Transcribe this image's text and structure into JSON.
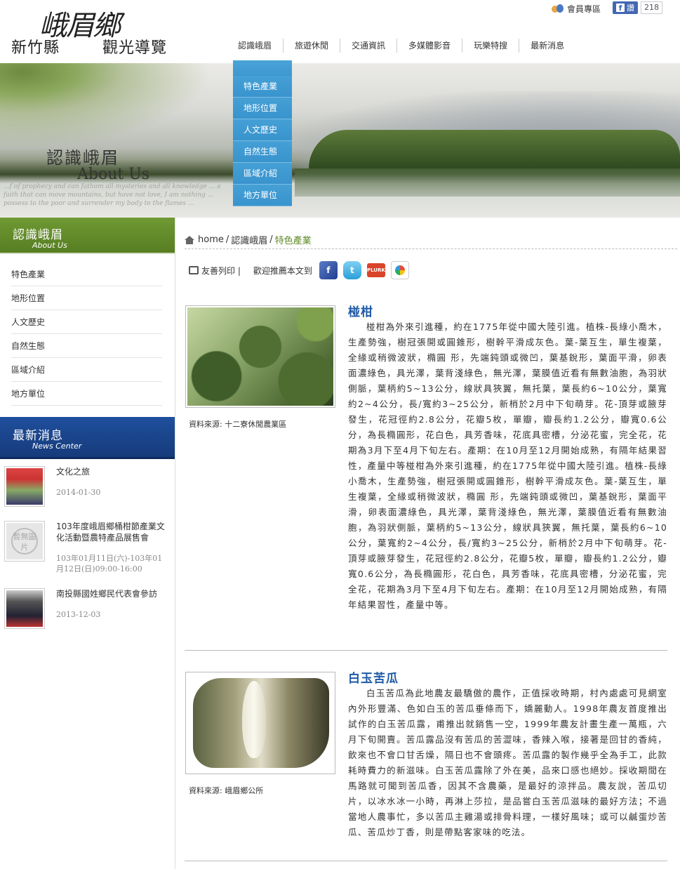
{
  "logo": {
    "prefix": "新竹縣",
    "big": "峨眉鄉",
    "suffix": "觀光導覽"
  },
  "header": {
    "member_label": "會員專區",
    "fb_label": "讚",
    "fb_count": "218",
    "nav": [
      "認識峨眉",
      "旅遊休閒",
      "交通資訊",
      "多媒體影音",
      "玩樂特搜",
      "最新消息"
    ]
  },
  "dropdown": [
    "特色產業",
    "地形位置",
    "人文歷史",
    "自然生態",
    "區域介紹",
    "地方單位"
  ],
  "banner": {
    "title_zh": "認識峨眉",
    "title_en": "About Us",
    "script": "...f of prophecy and can fathom all mysteries and all knowledge ... a faith that can move mountains, but have not love, I am nothing ... possess to the poor and surrender my body to the flames ..."
  },
  "sidebar": {
    "section_zh": "認識峨眉",
    "section_en": "About Us",
    "items": [
      "特色產業",
      "地形位置",
      "人文歷史",
      "自然生態",
      "區域介紹",
      "地方單位"
    ],
    "news_zh": "最新消息",
    "news_en": "News Center",
    "news": [
      {
        "title": "文化之旅",
        "date": "2014-01-30"
      },
      {
        "title": "103年度峨眉鄉桶柑節產業文化活動暨農特產品展售會",
        "date": "103年01月11日(六)-103年01月12日(日)09:00-16:00",
        "placeholder": "暫無圖片"
      },
      {
        "title": "南投縣國姓鄉民代表會參訪",
        "date": "2013-12-03"
      }
    ]
  },
  "breadcrumb": {
    "home": "home",
    "level1": "認識峨眉",
    "current": "特色產業",
    "sep": "/"
  },
  "share": {
    "print_label": "友善列印 |",
    "recommend_label": "歡迎推薦本文到",
    "plurk": "PLURK"
  },
  "products": [
    {
      "title": "椪柑",
      "source": "資料來源: 十二寮休閒農業區",
      "text": "椪柑為外來引進種，約在1775年從中國大陸引進。植株-長綠小喬木，生產勢強，樹冠張開或圓錐形，樹幹平滑成灰色。葉-葉互生，單生複葉，全緣或稍微波狀，橢圓 形，先端鈍頭或微凹，葉基銳形，葉面平滑，卵表面濃綠色，具光澤，葉背淺綠色，無光澤，葉膜值近看有無數油胞，為羽狀側脈，葉柄約5~13公分，線狀具狹翼，無托葉，葉長約6~10公分，葉寬約2~4公分，長/寬約3~25公分，新梢於2月中下旬萌芽。花-頂芽或腋芽發生，花冠徑約2.8公分，花瓣5枚，單瓣，瓣長約1.2公分，瓣寬0.6公分，為長橢圓形，花白色，具芳香味，花底具密槽，分泌花蜜，完全花，花期為3月下至4月下旬左右。產期：在10月至12月開始成熟，有隔年結果習性，產量中等椪柑為外來引進種，約在1775年從中國大陸引進。植株-長綠小喬木，生產勢強，樹冠張開或圓錐形，樹幹平滑成灰色。葉-葉互生，單生複葉，全緣或稍微波狀，橢圓 形，先端鈍頭或微凹，葉基銳形，葉面平滑，卵表面濃綠色，具光澤，葉背淺綠色，無光澤，葉膜值近看有無數油胞，為羽狀側脈，葉柄約5~13公分，線狀具狹翼，無托葉，葉長約6~10公分，葉寬約2~4公分，長/寬約3~25公分，新梢於2月中下旬萌芽。花-頂芽或腋芽發生，花冠徑約2.8公分，花瓣5枚，單瓣，瓣長約1.2公分，瓣寬0.6公分，為長橢圓形，花白色，具芳香味，花底具密槽，分泌花蜜，完全花，花期為3月下至4月下旬左右。產期：在10月至12月開始成熟，有隔年結果習性，產量中等。"
    },
    {
      "title": "白玉苦瓜",
      "source": "資料來源: 峨眉鄉公所",
      "text": "白玉苦瓜為此地農友最驕傲的農作，正值採收時期，村內處處可見網室內外形豐滿、色如白玉的苦瓜垂條而下，嬌麗動人。1998年農友首度推出試作的白玉苦瓜露，甫推出就銷售一空，1999年農友計畫生產一萬瓶，六月下旬開賣。苦瓜露品沒有苦瓜的苦澀味，香辣入喉，接著是回甘的香純，飲來也不會口甘舌燥，隔日也不會頭疼。苦瓜露的製作幾乎全為手工，此款耗時費力的新滋味。白玉苦瓜露除了外在美，品來口感也絕妙。採收期間在馬路就可聞到苦瓜香，因其不含農藥，是最好的涼拌品。農友說，苦瓜切片，以冰水冰一小時，再淋上莎拉，是品嘗白玉苦瓜滋味的最好方法；不過當地人農事忙，多以苦瓜主雞湯或排骨料理，一樣好風味；或可以鹹蛋炒苦瓜、苦瓜炒丁香，則是帶點客家味的吃法。"
    }
  ]
}
